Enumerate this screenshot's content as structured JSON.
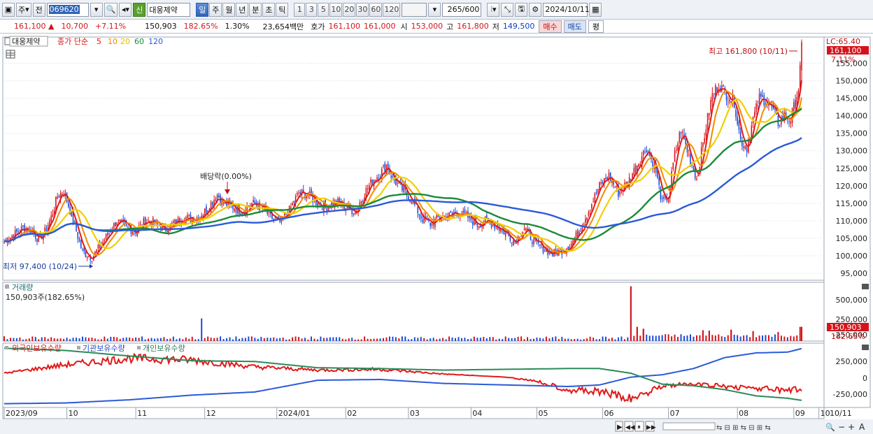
{
  "toolbar": {
    "type_select": "주",
    "prefix_select": "전",
    "stock_code": "069620",
    "stock_badge": "신",
    "stock_name": "대웅제약",
    "periods": [
      "일",
      "주",
      "월",
      "년",
      "분",
      "초",
      "틱"
    ],
    "active_period": "일",
    "intervals": [
      "1",
      "3",
      "5",
      "10",
      "20",
      "30",
      "60",
      "120"
    ],
    "count_value": "265",
    "count_max": "/600",
    "date": "2024/10/11"
  },
  "quote": {
    "price": "161,100",
    "change": "10,700",
    "change_pct": "+7.11%",
    "volume": "150,903",
    "volume_ratio": "182.65%",
    "turnover": "1.30%",
    "amount": "23,654백만",
    "ask_label": "호가",
    "ask1": "161,100",
    "ask2": "161,000",
    "open_label": "시",
    "open": "153,000",
    "high_label": "고",
    "high": "161,800",
    "low_label": "저",
    "low": "149,500",
    "buy_label": "매수",
    "sell_label": "매도",
    "eval_label": "평"
  },
  "price_pane": {
    "stock_name": "대웅제약",
    "ma_label": "종가 단순",
    "ma_periods": [
      {
        "p": "5",
        "color": "#e01a1a"
      },
      {
        "p": "10",
        "color": "#f08c00"
      },
      {
        "p": "20",
        "color": "#f0d000"
      },
      {
        "p": "60",
        "color": "#1a8a3a"
      },
      {
        "p": "120",
        "color": "#2a5ad8"
      }
    ],
    "lc_label": "LC:65.40",
    "current_price_tag": "161,100",
    "current_pct_tag": "7.11%",
    "high_note": "최고 161,800 (10/11)",
    "low_note": "최저 97,400 (10/24)",
    "dividend_note": "배당락(0.00%)",
    "y_ticks": [
      "155,000",
      "150,000",
      "145,000",
      "140,000",
      "135,000",
      "130,000",
      "125,000",
      "120,000",
      "115,000",
      "110,000",
      "105,000",
      "100,000",
      "95,000"
    ]
  },
  "volume_pane": {
    "title": "거래량",
    "value": "150,903주(182.65%)",
    "y_ticks": [
      "500,000",
      "250,000",
      "-250,000"
    ],
    "current_tag": "150,903",
    "current_pct": "182.65%"
  },
  "holding_pane": {
    "series": [
      {
        "name": "외국인보유수량",
        "color": "#e01a1a"
      },
      {
        "name": "기관보유수량",
        "color": "#2a5ad8"
      },
      {
        "name": "개인보유수량",
        "color": "#2a8a5a"
      }
    ],
    "y_ticks": [
      "250,000",
      "0",
      "-250,000"
    ]
  },
  "x_axis": {
    "labels": [
      "2023/09",
      "10",
      "11",
      "12",
      "2024/01",
      "02",
      "03",
      "04",
      "05",
      "06",
      "07",
      "08",
      "09",
      "10"
    ],
    "end_label": "10/11"
  },
  "chart_data": {
    "type": "candlestick",
    "y_range": [
      93000,
      162500
    ],
    "price_anchors": [
      [
        0,
        104000
      ],
      [
        6,
        106000
      ],
      [
        12,
        108000
      ],
      [
        18,
        107000
      ],
      [
        22,
        104500
      ],
      [
        26,
        107000
      ],
      [
        30,
        111000
      ],
      [
        34,
        117000
      ],
      [
        38,
        118500
      ],
      [
        42,
        113000
      ],
      [
        46,
        107000
      ],
      [
        50,
        101000
      ],
      [
        56,
        99500
      ],
      [
        60,
        102000
      ],
      [
        66,
        106000
      ],
      [
        72,
        110000
      ],
      [
        78,
        108000
      ],
      [
        84,
        107000
      ],
      [
        90,
        110000
      ],
      [
        96,
        109500
      ],
      [
        102,
        107500
      ],
      [
        108,
        109000
      ],
      [
        114,
        111000
      ],
      [
        120,
        110500
      ],
      [
        126,
        111500
      ],
      [
        132,
        115000
      ],
      [
        136,
        117500
      ],
      [
        140,
        115000
      ],
      [
        146,
        114000
      ],
      [
        152,
        112500
      ],
      [
        158,
        115000
      ],
      [
        164,
        114000
      ],
      [
        170,
        111000
      ],
      [
        176,
        109500
      ],
      [
        182,
        113000
      ],
      [
        188,
        118000
      ],
      [
        194,
        117500
      ],
      [
        200,
        115000
      ],
      [
        206,
        114000
      ],
      [
        212,
        115500
      ],
      [
        218,
        114000
      ],
      [
        224,
        112500
      ],
      [
        230,
        118000
      ],
      [
        236,
        122000
      ],
      [
        240,
        123500
      ],
      [
        244,
        126000
      ],
      [
        248,
        122000
      ],
      [
        254,
        119000
      ],
      [
        260,
        116000
      ],
      [
        266,
        111000
      ],
      [
        272,
        109000
      ],
      [
        278,
        111000
      ],
      [
        284,
        111500
      ],
      [
        290,
        112500
      ],
      [
        296,
        111000
      ],
      [
        302,
        109000
      ],
      [
        308,
        110000
      ],
      [
        314,
        108500
      ],
      [
        320,
        106500
      ],
      [
        326,
        104000
      ],
      [
        332,
        108000
      ],
      [
        338,
        104000
      ],
      [
        344,
        102000
      ],
      [
        350,
        100500
      ],
      [
        356,
        101500
      ],
      [
        362,
        103500
      ],
      [
        368,
        108000
      ],
      [
        374,
        114000
      ],
      [
        380,
        120000
      ],
      [
        386,
        123000
      ],
      [
        392,
        118000
      ],
      [
        398,
        121000
      ],
      [
        404,
        126000
      ],
      [
        410,
        131000
      ],
      [
        416,
        124000
      ],
      [
        420,
        115000
      ],
      [
        424,
        117000
      ],
      [
        428,
        129000
      ],
      [
        432,
        136000
      ],
      [
        436,
        130000
      ],
      [
        442,
        122000
      ],
      [
        448,
        137000
      ],
      [
        452,
        146000
      ],
      [
        456,
        149000
      ],
      [
        460,
        146500
      ],
      [
        466,
        144000
      ],
      [
        470,
        133000
      ],
      [
        474,
        131000
      ],
      [
        478,
        139000
      ],
      [
        482,
        145000
      ],
      [
        486,
        144500
      ],
      [
        490,
        142000
      ],
      [
        494,
        138000
      ],
      [
        498,
        140000
      ],
      [
        502,
        139000
      ],
      [
        505,
        144000
      ],
      [
        507,
        148000
      ],
      [
        509,
        161100
      ]
    ],
    "n": 510,
    "ma_periods": [
      5,
      10,
      20,
      60,
      120
    ],
    "high": {
      "value": 161800,
      "date": "10/11"
    },
    "low": {
      "value": 97400,
      "date": "10/24"
    },
    "volume_max": 600000,
    "volume_spikes": [
      [
        126,
        240000
      ],
      [
        400,
        580000
      ],
      [
        404,
        150000
      ],
      [
        408,
        130000
      ],
      [
        446,
        115000
      ],
      [
        450,
        110000
      ],
      [
        464,
        120000
      ],
      [
        478,
        105000
      ],
      [
        494,
        95000
      ],
      [
        510,
        150903
      ]
    ],
    "holdings": {
      "foreign": [
        [
          0,
          40000
        ],
        [
          40,
          150000
        ],
        [
          80,
          230000
        ],
        [
          120,
          210000
        ],
        [
          160,
          120000
        ],
        [
          200,
          80000
        ],
        [
          240,
          90000
        ],
        [
          280,
          30000
        ],
        [
          320,
          -10000
        ],
        [
          340,
          -60000
        ],
        [
          360,
          -170000
        ],
        [
          380,
          -200000
        ],
        [
          400,
          -290000
        ],
        [
          420,
          -120000
        ],
        [
          440,
          -100000
        ],
        [
          460,
          -130000
        ],
        [
          480,
          -150000
        ],
        [
          500,
          -190000
        ],
        [
          510,
          -150000
        ]
      ],
      "institution": [
        [
          0,
          -350000
        ],
        [
          40,
          -340000
        ],
        [
          80,
          -300000
        ],
        [
          120,
          -240000
        ],
        [
          160,
          -200000
        ],
        [
          200,
          -50000
        ],
        [
          240,
          -40000
        ],
        [
          280,
          -90000
        ],
        [
          320,
          -110000
        ],
        [
          360,
          -130000
        ],
        [
          380,
          -110000
        ],
        [
          400,
          -10000
        ],
        [
          420,
          20000
        ],
        [
          440,
          100000
        ],
        [
          460,
          240000
        ],
        [
          480,
          300000
        ],
        [
          500,
          310000
        ],
        [
          510,
          360000
        ]
      ],
      "individual": [
        [
          0,
          360000
        ],
        [
          40,
          330000
        ],
        [
          80,
          260000
        ],
        [
          120,
          200000
        ],
        [
          160,
          190000
        ],
        [
          200,
          110000
        ],
        [
          240,
          100000
        ],
        [
          280,
          80000
        ],
        [
          320,
          90000
        ],
        [
          360,
          100000
        ],
        [
          380,
          100000
        ],
        [
          400,
          40000
        ],
        [
          420,
          -100000
        ],
        [
          440,
          -120000
        ],
        [
          460,
          -170000
        ],
        [
          480,
          -250000
        ],
        [
          500,
          -280000
        ],
        [
          510,
          -310000
        ]
      ]
    }
  }
}
